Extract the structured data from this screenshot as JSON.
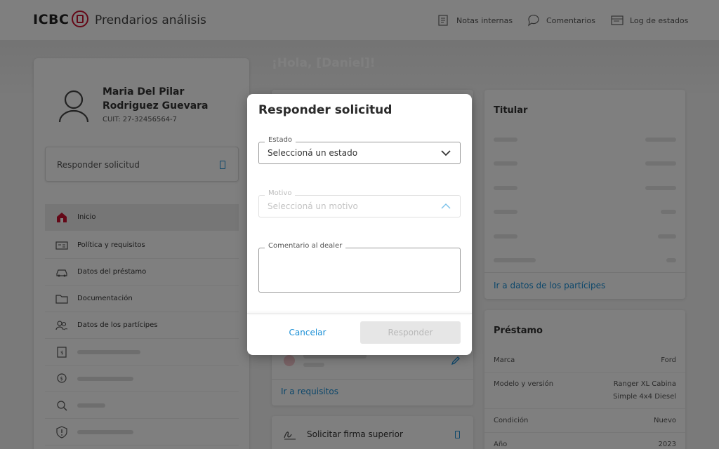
{
  "header": {
    "logo_text": "ICBC",
    "app_title": "Prendarios análisis",
    "nav": [
      {
        "label": "Notas internas",
        "icon": "notes-icon"
      },
      {
        "label": "Comentarios",
        "icon": "comments-icon"
      },
      {
        "label": "Log de estados",
        "icon": "log-icon"
      }
    ]
  },
  "greeting": "¡Hola, [Daniel]!",
  "user": {
    "name": "Maria Del Pilar Rodriguez Guevara",
    "cuit": "CUIT: 27-32456564-7"
  },
  "sidebar": {
    "respond_label": "Responder solicitud",
    "items": [
      {
        "label": "Inicio",
        "active": true
      },
      {
        "label": "Política y requisitos"
      },
      {
        "label": "Datos del préstamo"
      },
      {
        "label": "Documentación"
      },
      {
        "label": "Datos de los partícipes"
      }
    ]
  },
  "middle": {
    "link": "Ir a requisitos",
    "firma_label": "Solicitar firma superior"
  },
  "titular_card": {
    "title": "Titular",
    "link": "Ir a datos de los partícipes"
  },
  "prestamo_card": {
    "title": "Préstamo",
    "rows": [
      {
        "key": "Marca",
        "value": "Ford"
      },
      {
        "key": "Modelo y versión",
        "value": "Ranger XL Cabina Simple 4x4 Diesel"
      },
      {
        "key": "Condición",
        "value": "Nuevo"
      },
      {
        "key": "Año",
        "value": "2023"
      }
    ]
  },
  "modal": {
    "title": "Responder solicitud",
    "estado": {
      "label": "Estado",
      "value": "Seleccioná un estado"
    },
    "motivo": {
      "label": "Motivo",
      "value": "Seleccioná un motivo"
    },
    "comentario": {
      "label": "Comentario al dealer",
      "value": ""
    },
    "cancel_label": "Cancelar",
    "submit_label": "Responder"
  },
  "colors": {
    "accent": "#1a8fd6",
    "brand_red": "#c8102e"
  }
}
